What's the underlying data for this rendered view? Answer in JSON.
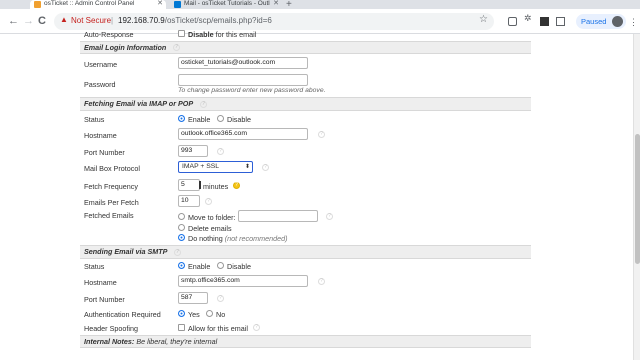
{
  "browser": {
    "tabs": [
      {
        "title": "osTicket :: Admin Control Panel",
        "favicon_color": "#f0a030"
      },
      {
        "title": "Mail - osTicket Tutorials - Outl",
        "favicon_color": "#0078d4"
      }
    ],
    "new_tab": "+",
    "nav": {
      "back": "←",
      "forward": "→",
      "reload": "C"
    },
    "security_label": "Not Secure",
    "separator": "|",
    "url_host": "192.168.70.9",
    "url_path": "/osTicket/scp/emails.php?id=6",
    "profile_label": "Paused"
  },
  "form": {
    "auto_response": {
      "label": "Auto-Response",
      "checkbox_label": "Disable",
      "suffix": " for this email"
    },
    "login_section": "Email Login Information",
    "username": {
      "label": "Username",
      "value": "osticket_tutorials@outlook.com"
    },
    "password": {
      "label": "Password",
      "value": "",
      "hint": "To change password enter new password above."
    },
    "fetch_section": "Fetching Email via IMAP or POP",
    "status": {
      "label": "Status",
      "enable": "Enable",
      "disable": "Disable"
    },
    "hostname": {
      "label": "Hostname",
      "value": "outlook.office365.com"
    },
    "port": {
      "label": "Port Number",
      "value": "993"
    },
    "protocol": {
      "label": "Mail Box Protocol",
      "value": "IMAP + SSL"
    },
    "frequency": {
      "label": "Fetch Frequency",
      "value": "5",
      "unit": "minutes"
    },
    "per_fetch": {
      "label": "Emails Per Fetch",
      "value": "10"
    },
    "fetched": {
      "label": "Fetched Emails",
      "move": "Move to folder:",
      "delete": "Delete emails",
      "nothing": "Do nothing",
      "nothing_note": "(not recommended)"
    },
    "smtp_section": "Sending Email via SMTP",
    "smtp_status": {
      "label": "Status",
      "enable": "Enable",
      "disable": "Disable"
    },
    "smtp_hostname": {
      "label": "Hostname",
      "value": "smtp.office365.com"
    },
    "smtp_port": {
      "label": "Port Number",
      "value": "587"
    },
    "auth": {
      "label": "Authentication Required",
      "yes": "Yes",
      "no": "No"
    },
    "spoofing": {
      "label": "Header Spoofing",
      "checkbox_label": "Allow for this email"
    },
    "notes_section": "Internal Notes:",
    "notes_hint": "Be liberal, they're internal"
  }
}
